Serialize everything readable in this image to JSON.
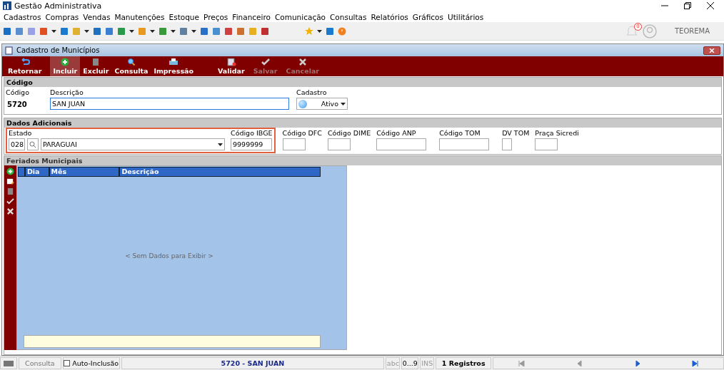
{
  "window": {
    "title": "Gestão Administrativa"
  },
  "menu": [
    "Cadastros",
    "Compras",
    "Vendas",
    "Manutenções",
    "Estoque",
    "Preços",
    "Financeiro",
    "Comunicação",
    "Consultas",
    "Relatórios",
    "Gráficos",
    "Utilitários"
  ],
  "notifications": {
    "count": "0"
  },
  "user": {
    "name": "TEOREMA"
  },
  "form": {
    "title": "Cadastro de Municípios",
    "actions": [
      {
        "kind": "return",
        "label": "Retornar",
        "selected": false,
        "disabled": false
      },
      {
        "kind": "add",
        "label": "Incluir",
        "selected": true,
        "disabled": false
      },
      {
        "kind": "delete",
        "label": "Excluir",
        "selected": false,
        "disabled": false
      },
      {
        "kind": "search",
        "label": "Consulta",
        "selected": false,
        "disabled": false
      },
      {
        "kind": "print",
        "label": "Impressão",
        "selected": false,
        "disabled": false
      },
      {
        "kind": "validate",
        "label": "Validar",
        "selected": false,
        "disabled": false
      },
      {
        "kind": "save",
        "label": "Salvar",
        "selected": false,
        "disabled": true
      },
      {
        "kind": "cancel",
        "label": "Cancelar",
        "selected": false,
        "disabled": true
      }
    ],
    "code_section": {
      "title": "Código",
      "code_label": "Código",
      "code": "5720",
      "description_label": "Descrição",
      "description": "SAN JUAN",
      "status_label": "Cadastro",
      "status": "Ativo"
    },
    "extra_section": {
      "title": "Dados Adicionais",
      "state_label": "Estado",
      "state_code": "028",
      "state_name": "PARAGUAI",
      "ibge_label": "Código IBGE",
      "ibge": "9999999",
      "fields": [
        {
          "label": "Código DFC"
        },
        {
          "label": "Código DIME"
        },
        {
          "label": "Código ANP"
        },
        {
          "label": "Código TOM"
        },
        {
          "label": "DV TOM"
        },
        {
          "label": "Praça Sicredi"
        }
      ]
    },
    "holidays": {
      "title": "Feriados Municipais",
      "columns": [
        "Dia",
        "Mês",
        "Descrição"
      ],
      "empty": "< Sem Dados para Exibir >"
    }
  },
  "status_bar": {
    "mode": "Consulta",
    "auto_include": {
      "label": "Auto-Inclusão",
      "checked": false
    },
    "record": "5720 - SAN JUAN",
    "abc": "abc",
    "digits": "0...9",
    "ins": "INS",
    "count": "1 Registros",
    "nav": [
      {
        "kind": "first",
        "disabled": true
      },
      {
        "kind": "prev",
        "disabled": true
      },
      {
        "kind": "next",
        "disabled": false
      },
      {
        "kind": "last",
        "disabled": false
      }
    ]
  }
}
